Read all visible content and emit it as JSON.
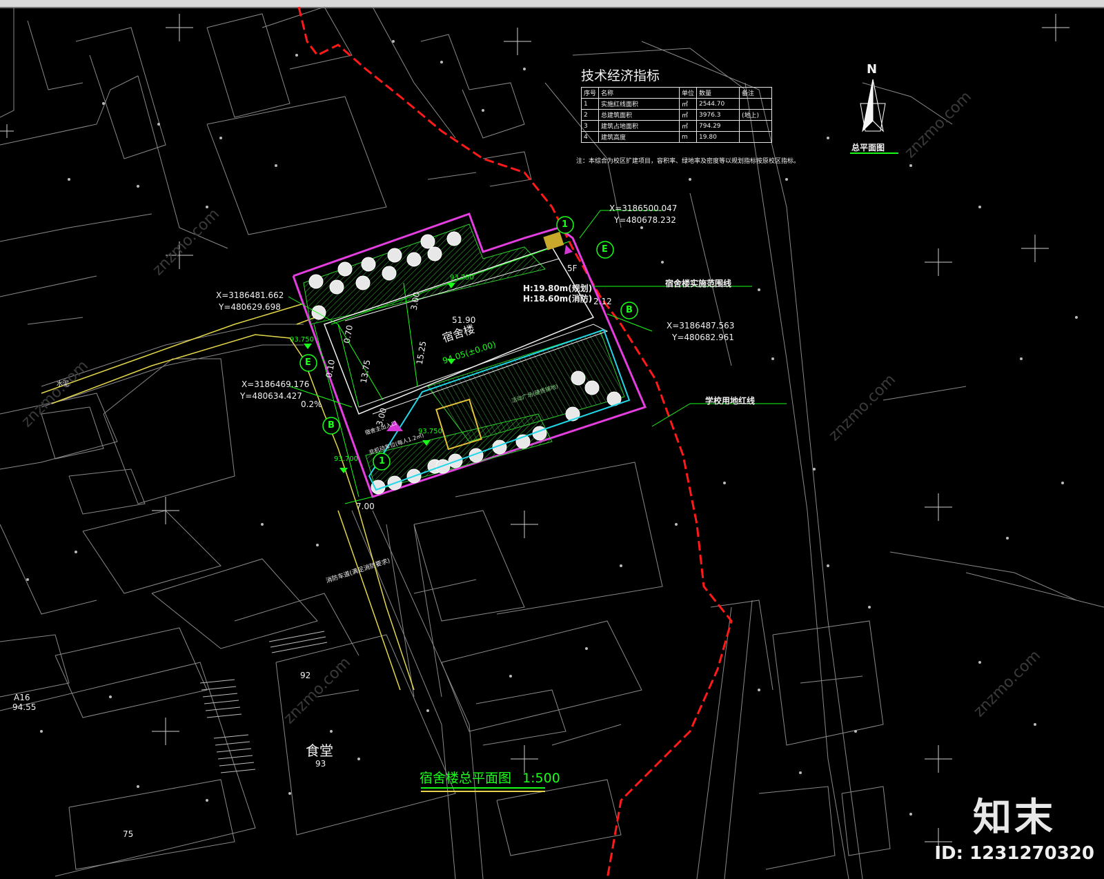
{
  "tech_table": {
    "title": "技术经济指标",
    "headers": [
      "序号",
      "名称",
      "单位",
      "数量",
      "备注"
    ],
    "rows": [
      [
        "1",
        "实施红线面积",
        "㎡",
        "2544.70",
        ""
      ],
      [
        "2",
        "总建筑面积",
        "㎡",
        "3976.3",
        "(地上)"
      ],
      [
        "3",
        "建筑占地面积",
        "㎡",
        "794.29",
        ""
      ],
      [
        "4",
        "建筑高度",
        "m",
        "19.80",
        ""
      ]
    ],
    "note": "注：本综合为校区扩建项目，容积率、绿地率及密度等以规划指标按原校区指标。"
  },
  "compass": {
    "north": "N",
    "caption": "总平面图"
  },
  "coords": [
    {
      "x": "X=3186500.047",
      "y": "Y=480678.232"
    },
    {
      "x": "X=3186481.662",
      "y": "Y=480629.698"
    },
    {
      "x": "X=3186487.563",
      "y": "Y=480682.961"
    },
    {
      "x": "X=3186469.176",
      "y": "Y=480634.427"
    }
  ],
  "callouts": {
    "dorm_boundary": "宿舍楼实施范围线",
    "school_redline": "学校用地红线",
    "fire_road": "消防车道(满足消防要求)"
  },
  "building": {
    "name": "宿舍楼",
    "floors": "5F",
    "height_plan": "H:19.80m(规划)",
    "height_fire": "H:18.60m(消防)",
    "elevation": "94.05(±0.00)",
    "entrance": "宿舍主出入口",
    "bike_parking": "非机动车位(每人1.2㎡)",
    "plaza": "活动广场(硬质铺地)"
  },
  "dims": {
    "length": "51.90",
    "depth": "15.25",
    "d1": "13.75",
    "d2": "3.00",
    "d3": "0.70",
    "d4": "0.10",
    "d5": "7.00",
    "d6": "2.12",
    "d7": "0.2%",
    "d8": "3.00",
    "e1": "93.750",
    "e2": "93.750",
    "e3": "93.700",
    "e4": "93.750"
  },
  "axis_markers": [
    "1",
    "E",
    "E",
    "B",
    "B",
    "1"
  ],
  "map_labels": {
    "canteen": "食堂",
    "canteen_num": "93",
    "n92": "92",
    "a16": "A16",
    "a16_elev": "94.55",
    "water": "水泥",
    "n75": "75"
  },
  "drawing_title": {
    "text": "宿舍楼总平面图",
    "scale": "1:500"
  },
  "watermark": {
    "brand": "知末",
    "id": "ID: 1231270320"
  }
}
